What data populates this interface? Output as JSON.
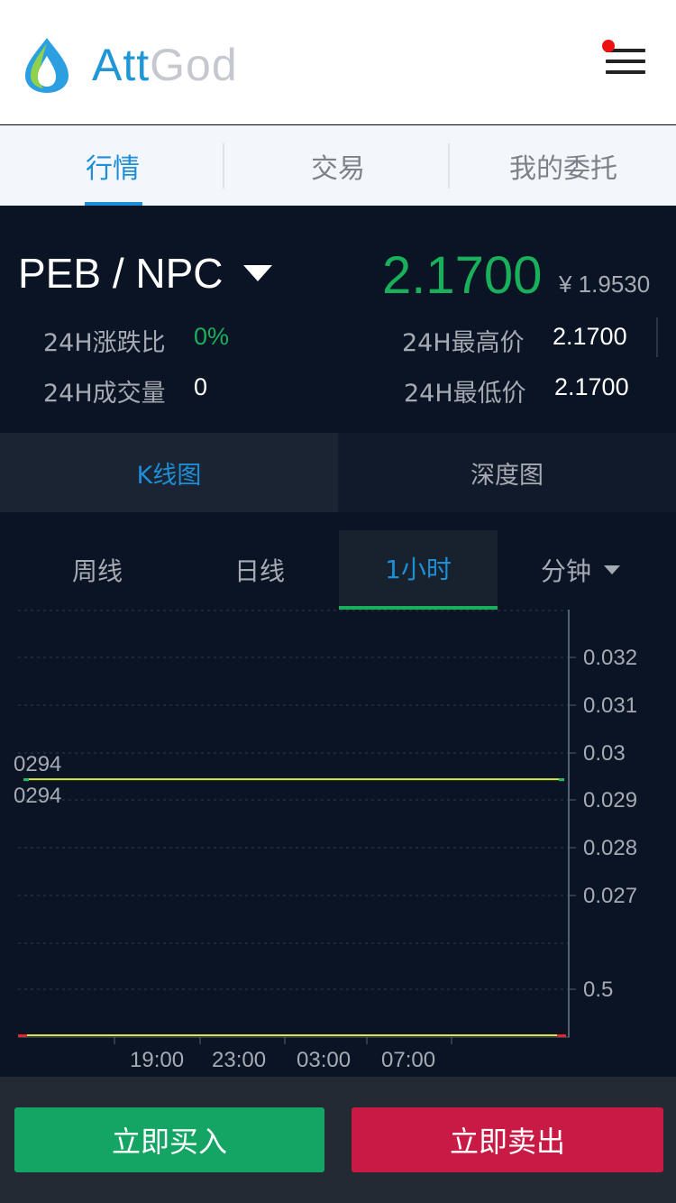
{
  "header": {
    "logo_primary": "Att",
    "logo_secondary": "God",
    "menu_icon": "hamburger-menu-icon",
    "notification_color": "#ee1111"
  },
  "nav_tabs": [
    {
      "label": "行情",
      "active": true
    },
    {
      "label": "交易",
      "active": false
    },
    {
      "label": "我的委托",
      "active": false
    }
  ],
  "ticker": {
    "pair": "PEB / NPC",
    "last_price": "2.1700",
    "cny_price": "¥ 1.9530",
    "change_label": "24H涨跌比",
    "change_value": "0%",
    "volume_label": "24H成交量",
    "volume_value": "0",
    "high_label": "24H最高价",
    "high_value": "2.1700",
    "low_label": "24H最低价",
    "low_value": "2.1700"
  },
  "chart_tabs": [
    {
      "label": "K线图",
      "active": true
    },
    {
      "label": "深度图",
      "active": false
    }
  ],
  "period_tabs": [
    {
      "label": "周线",
      "active": false
    },
    {
      "label": "日线",
      "active": false
    },
    {
      "label": "1小时",
      "active": true
    },
    {
      "label": "分钟",
      "active": false,
      "dropdown": true
    }
  ],
  "chart_data": {
    "type": "line",
    "price_axis_ticks": [
      "0.032",
      "0.031",
      "0.03",
      "0.029",
      "0.028",
      "0.027"
    ],
    "volume_axis_ticks": [
      "0.5"
    ],
    "x_tick_labels": [
      "19:00",
      "23:00",
      "03:00",
      "07:00"
    ],
    "price_line_label_top": "0294",
    "price_line_label_bottom": "0294",
    "price_level": 0.02944,
    "volume_level": 0,
    "line_color": "#d8e83a"
  },
  "actions": {
    "buy_label": "立即买入",
    "sell_label": "立即卖出"
  },
  "colors": {
    "accent": "#1e8fd6",
    "up_green": "#18b05a",
    "buy": "#14a464",
    "sell": "#c81a44"
  }
}
